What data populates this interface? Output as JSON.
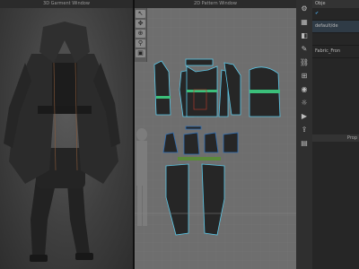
{
  "titles": {
    "view3d": "3D Garment Window",
    "view2d": "2D Pattern Window"
  },
  "tools2d": [
    {
      "icon": "select-icon",
      "glyph": "↖"
    },
    {
      "icon": "transform-icon",
      "glyph": "✥"
    },
    {
      "icon": "zoom-icon",
      "glyph": "⊕"
    },
    {
      "icon": "pin-icon",
      "glyph": "⚲"
    },
    {
      "icon": "fit-icon",
      "glyph": "▣"
    }
  ],
  "right_tools": [
    {
      "icon": "gear-icon",
      "glyph": "⚙"
    },
    {
      "icon": "grid-icon",
      "glyph": "▦"
    },
    {
      "icon": "layers-icon",
      "glyph": "◧"
    },
    {
      "icon": "brush-icon",
      "glyph": "✎"
    },
    {
      "icon": "link-icon",
      "glyph": "⛓"
    },
    {
      "icon": "measure-icon",
      "glyph": "⊞"
    },
    {
      "icon": "camera-icon",
      "glyph": "◉"
    },
    {
      "icon": "light-icon",
      "glyph": "☼"
    },
    {
      "icon": "render-icon",
      "glyph": "▶"
    },
    {
      "icon": "export-icon",
      "glyph": "⇪"
    },
    {
      "icon": "save-icon",
      "glyph": "▤"
    }
  ],
  "object_browser": {
    "header": "Obje",
    "items": [
      {
        "label": "",
        "checked": true
      },
      {
        "label": "default/de",
        "selected": true
      },
      {
        "label": ""
      },
      {
        "label": "Fabric_Fron"
      }
    ],
    "lower_header": "Prop"
  },
  "colors": {
    "garment": "#262626",
    "accent_green": "#3bbf7a",
    "seam_blue": "#2f6fb5",
    "outline_cyan": "#5ac8e8",
    "grid": "#828282"
  }
}
